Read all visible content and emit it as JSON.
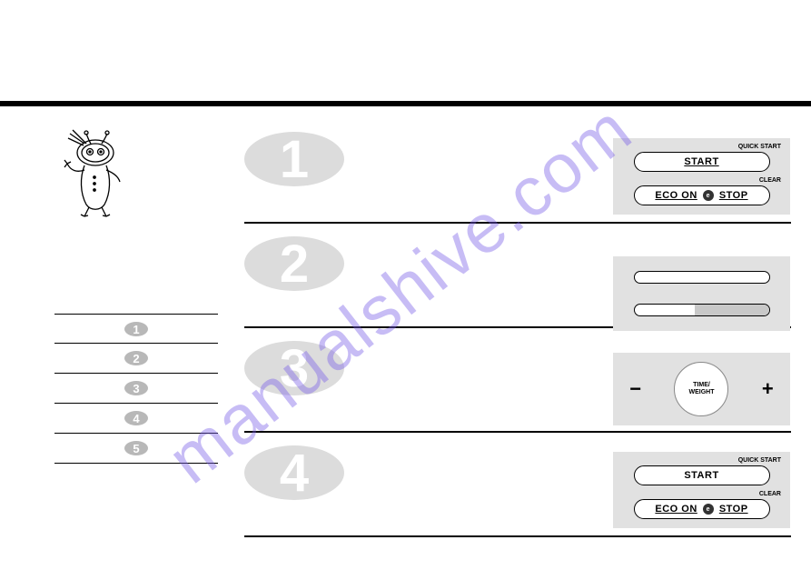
{
  "watermark": "manualshive.com",
  "panel1": {
    "quick_start": "QUICK START",
    "start": "START",
    "clear": "CLEAR",
    "eco": "ECO ON",
    "eco_icon": "e",
    "stop": "STOP"
  },
  "panel3": {
    "minus": "−",
    "circle_l1": "TIME/",
    "circle_l2": "WEIGHT",
    "plus": "+"
  },
  "panel4": {
    "quick_start": "QUICK START",
    "start": "START",
    "clear": "CLEAR",
    "eco": "ECO ON",
    "eco_icon": "e",
    "stop": "STOP"
  },
  "left_nums": [
    "1",
    "2",
    "3",
    "4",
    "5"
  ],
  "step_nums": [
    "1",
    "2",
    "3",
    "4"
  ]
}
